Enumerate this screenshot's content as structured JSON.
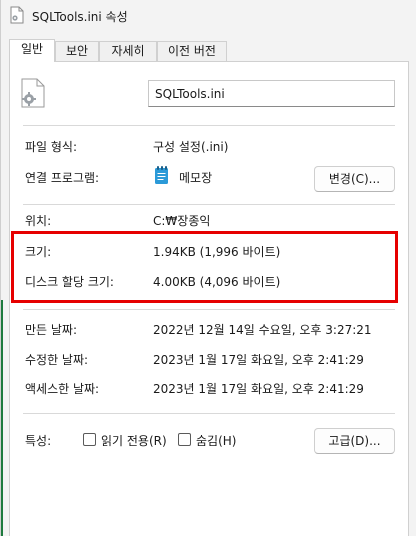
{
  "window": {
    "title": "SQLTools.ini 속성"
  },
  "tabs": [
    {
      "label": "일반",
      "active": true
    },
    {
      "label": "보안",
      "active": false
    },
    {
      "label": "자세히",
      "active": false
    },
    {
      "label": "이전 버전",
      "active": false
    }
  ],
  "general": {
    "file_name": "SQLTools.ini",
    "file_type_label": "파일 형식:",
    "file_type_value": "구성 설정(.ini)",
    "opens_with_label": "연결 프로그램:",
    "opens_with_value": "메모장",
    "change_button": "변경(C)...",
    "location_label": "위치:",
    "location_value": "C:₩장종익",
    "size_label": "크기:",
    "size_value": "1.94KB (1,996 바이트)",
    "size_on_disk_label": "디스크 할당 크기:",
    "size_on_disk_value": "4.00KB (4,096 바이트)",
    "created_label": "만든 날짜:",
    "created_value": "2022년 12월 14일 수요일, 오후 3:27:21",
    "modified_label": "수정한 날짜:",
    "modified_value": "2023년 1월 17일 화요일, 오후 2:41:29",
    "accessed_label": "액세스한 날짜:",
    "accessed_value": "2023년 1월 17일 화요일, 오후 2:41:29",
    "attributes_label": "특성:",
    "readonly_label": "읽기 전용(R)",
    "readonly_checked": false,
    "hidden_label": "숨김(H)",
    "hidden_checked": false,
    "advanced_button": "고급(D)..."
  },
  "colors": {
    "highlight_border": "#e60000",
    "notepad_icon": "#2b9ad8"
  },
  "icons": {
    "title": "settings-file-icon",
    "file": "settings-file-icon",
    "program": "notepad-icon"
  }
}
